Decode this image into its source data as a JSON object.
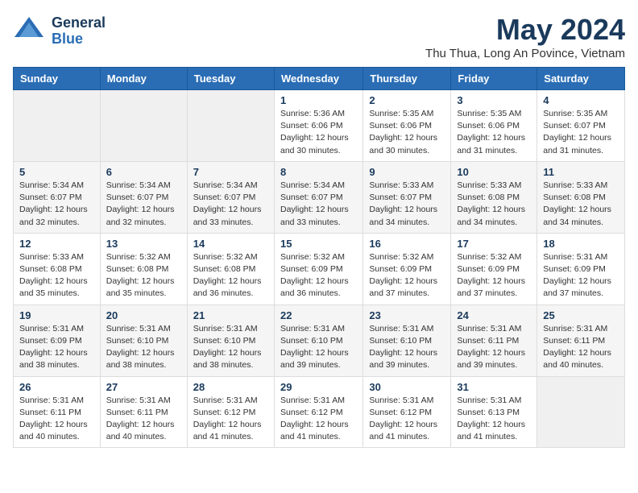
{
  "header": {
    "logo_general": "General",
    "logo_blue": "Blue",
    "month_year": "May 2024",
    "location": "Thu Thua, Long An Povince, Vietnam"
  },
  "weekdays": [
    "Sunday",
    "Monday",
    "Tuesday",
    "Wednesday",
    "Thursday",
    "Friday",
    "Saturday"
  ],
  "weeks": [
    [
      {
        "day": "",
        "info": ""
      },
      {
        "day": "",
        "info": ""
      },
      {
        "day": "",
        "info": ""
      },
      {
        "day": "1",
        "info": "Sunrise: 5:36 AM\nSunset: 6:06 PM\nDaylight: 12 hours\nand 30 minutes."
      },
      {
        "day": "2",
        "info": "Sunrise: 5:35 AM\nSunset: 6:06 PM\nDaylight: 12 hours\nand 30 minutes."
      },
      {
        "day": "3",
        "info": "Sunrise: 5:35 AM\nSunset: 6:06 PM\nDaylight: 12 hours\nand 31 minutes."
      },
      {
        "day": "4",
        "info": "Sunrise: 5:35 AM\nSunset: 6:07 PM\nDaylight: 12 hours\nand 31 minutes."
      }
    ],
    [
      {
        "day": "5",
        "info": "Sunrise: 5:34 AM\nSunset: 6:07 PM\nDaylight: 12 hours\nand 32 minutes."
      },
      {
        "day": "6",
        "info": "Sunrise: 5:34 AM\nSunset: 6:07 PM\nDaylight: 12 hours\nand 32 minutes."
      },
      {
        "day": "7",
        "info": "Sunrise: 5:34 AM\nSunset: 6:07 PM\nDaylight: 12 hours\nand 33 minutes."
      },
      {
        "day": "8",
        "info": "Sunrise: 5:34 AM\nSunset: 6:07 PM\nDaylight: 12 hours\nand 33 minutes."
      },
      {
        "day": "9",
        "info": "Sunrise: 5:33 AM\nSunset: 6:07 PM\nDaylight: 12 hours\nand 34 minutes."
      },
      {
        "day": "10",
        "info": "Sunrise: 5:33 AM\nSunset: 6:08 PM\nDaylight: 12 hours\nand 34 minutes."
      },
      {
        "day": "11",
        "info": "Sunrise: 5:33 AM\nSunset: 6:08 PM\nDaylight: 12 hours\nand 34 minutes."
      }
    ],
    [
      {
        "day": "12",
        "info": "Sunrise: 5:33 AM\nSunset: 6:08 PM\nDaylight: 12 hours\nand 35 minutes."
      },
      {
        "day": "13",
        "info": "Sunrise: 5:32 AM\nSunset: 6:08 PM\nDaylight: 12 hours\nand 35 minutes."
      },
      {
        "day": "14",
        "info": "Sunrise: 5:32 AM\nSunset: 6:08 PM\nDaylight: 12 hours\nand 36 minutes."
      },
      {
        "day": "15",
        "info": "Sunrise: 5:32 AM\nSunset: 6:09 PM\nDaylight: 12 hours\nand 36 minutes."
      },
      {
        "day": "16",
        "info": "Sunrise: 5:32 AM\nSunset: 6:09 PM\nDaylight: 12 hours\nand 37 minutes."
      },
      {
        "day": "17",
        "info": "Sunrise: 5:32 AM\nSunset: 6:09 PM\nDaylight: 12 hours\nand 37 minutes."
      },
      {
        "day": "18",
        "info": "Sunrise: 5:31 AM\nSunset: 6:09 PM\nDaylight: 12 hours\nand 37 minutes."
      }
    ],
    [
      {
        "day": "19",
        "info": "Sunrise: 5:31 AM\nSunset: 6:09 PM\nDaylight: 12 hours\nand 38 minutes."
      },
      {
        "day": "20",
        "info": "Sunrise: 5:31 AM\nSunset: 6:10 PM\nDaylight: 12 hours\nand 38 minutes."
      },
      {
        "day": "21",
        "info": "Sunrise: 5:31 AM\nSunset: 6:10 PM\nDaylight: 12 hours\nand 38 minutes."
      },
      {
        "day": "22",
        "info": "Sunrise: 5:31 AM\nSunset: 6:10 PM\nDaylight: 12 hours\nand 39 minutes."
      },
      {
        "day": "23",
        "info": "Sunrise: 5:31 AM\nSunset: 6:10 PM\nDaylight: 12 hours\nand 39 minutes."
      },
      {
        "day": "24",
        "info": "Sunrise: 5:31 AM\nSunset: 6:11 PM\nDaylight: 12 hours\nand 39 minutes."
      },
      {
        "day": "25",
        "info": "Sunrise: 5:31 AM\nSunset: 6:11 PM\nDaylight: 12 hours\nand 40 minutes."
      }
    ],
    [
      {
        "day": "26",
        "info": "Sunrise: 5:31 AM\nSunset: 6:11 PM\nDaylight: 12 hours\nand 40 minutes."
      },
      {
        "day": "27",
        "info": "Sunrise: 5:31 AM\nSunset: 6:11 PM\nDaylight: 12 hours\nand 40 minutes."
      },
      {
        "day": "28",
        "info": "Sunrise: 5:31 AM\nSunset: 6:12 PM\nDaylight: 12 hours\nand 41 minutes."
      },
      {
        "day": "29",
        "info": "Sunrise: 5:31 AM\nSunset: 6:12 PM\nDaylight: 12 hours\nand 41 minutes."
      },
      {
        "day": "30",
        "info": "Sunrise: 5:31 AM\nSunset: 6:12 PM\nDaylight: 12 hours\nand 41 minutes."
      },
      {
        "day": "31",
        "info": "Sunrise: 5:31 AM\nSunset: 6:13 PM\nDaylight: 12 hours\nand 41 minutes."
      },
      {
        "day": "",
        "info": ""
      }
    ]
  ]
}
